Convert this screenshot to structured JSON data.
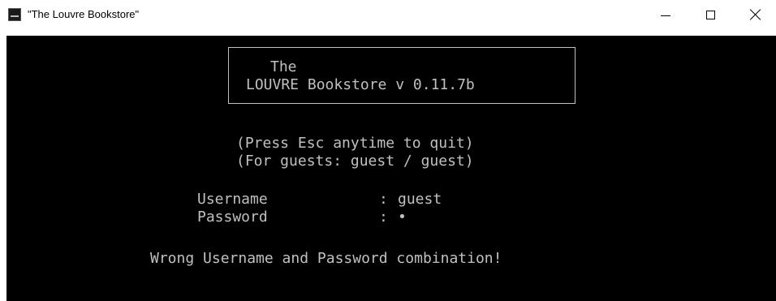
{
  "window": {
    "title": "\"The Louvre Bookstore\"",
    "icon": "console-app-icon",
    "controls": {
      "minimize": "minimize-icon",
      "maximize": "maximize-icon",
      "close": "close-icon"
    }
  },
  "console": {
    "banner": {
      "line1": "The",
      "line2": "LOUVRE Bookstore v 0.11.7b"
    },
    "hints": {
      "line1": "(Press Esc anytime to quit)",
      "line2": "(For guests: guest / guest)"
    },
    "login": {
      "username_label": "Username",
      "password_label": "Password",
      "separator": ":",
      "username_value": "guest",
      "password_value": "•"
    },
    "error": "Wrong Username and Password combination!"
  },
  "colors": {
    "console_bg": "#000000",
    "console_fg": "#c0c0c0",
    "titlebar_bg": "#ffffff"
  }
}
